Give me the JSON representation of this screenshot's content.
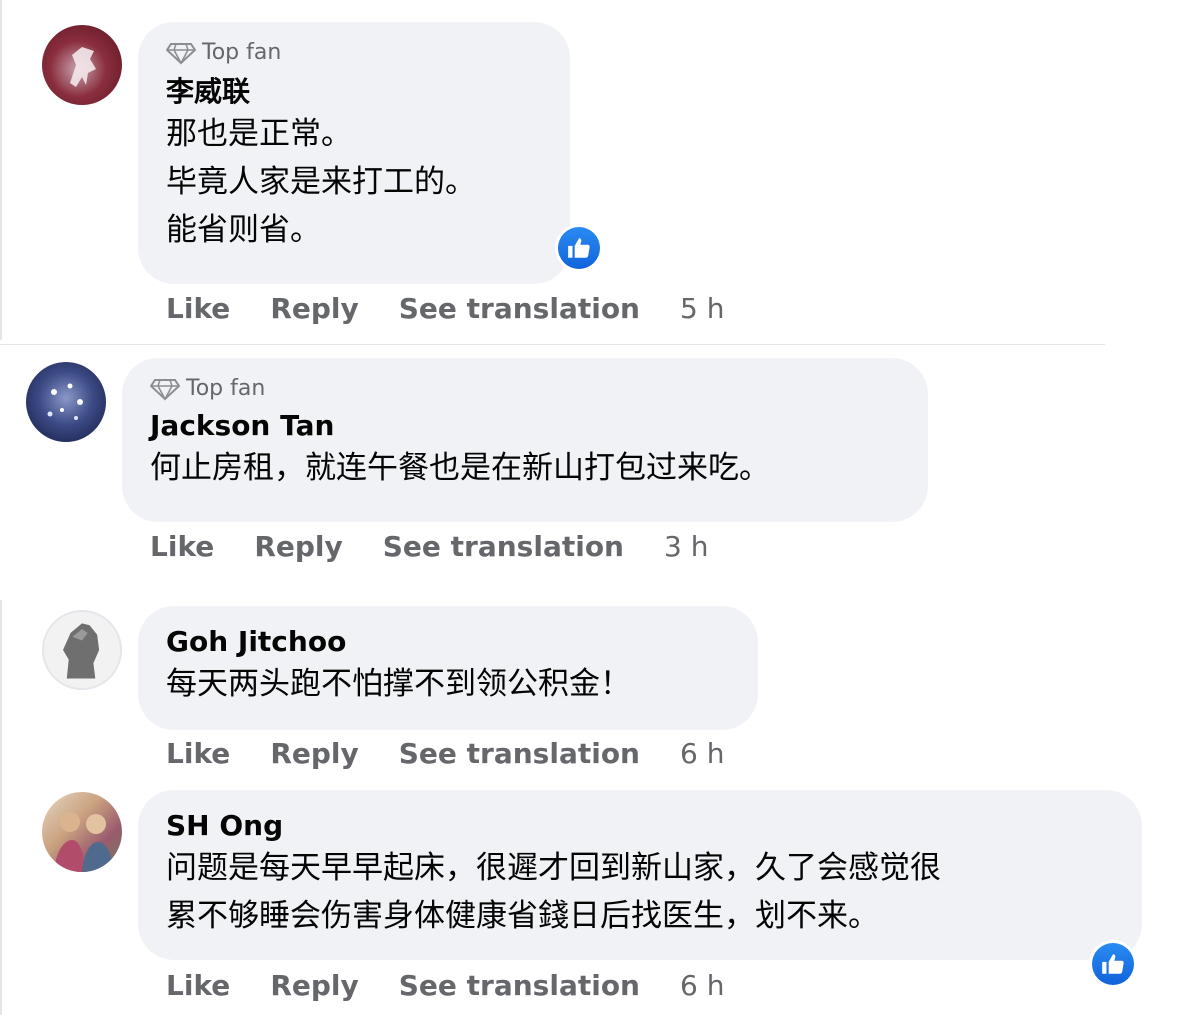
{
  "comments": [
    {
      "badge": "Top fan",
      "author": "李威联",
      "text": "那也是正常。\n毕竟人家是来打工的。\n能省则省。",
      "actions": {
        "like": "Like",
        "reply": "Reply",
        "translate": "See translation",
        "time": "5 h"
      },
      "reaction": "like-icon"
    },
    {
      "badge": "Top fan",
      "author": "Jackson Tan",
      "text": "何止房租，就连午餐也是在新山打包过来吃。",
      "actions": {
        "like": "Like",
        "reply": "Reply",
        "translate": "See translation",
        "time": "3 h"
      }
    },
    {
      "author": "Goh Jitchoo",
      "text": "每天两头跑不怕撑不到领公积金！",
      "actions": {
        "like": "Like",
        "reply": "Reply",
        "translate": "See translation",
        "time": "6 h"
      }
    },
    {
      "author": "SH Ong",
      "text": "问题是每天早早起床，很遲才回到新山家，久了会感觉很\n累不够睡会伤害身体健康省錢日后找医生，划不来。",
      "actions": {
        "like": "Like",
        "reply": "Reply",
        "translate": "See translation",
        "time": "6 h"
      },
      "reaction": "like-icon"
    }
  ],
  "colors": {
    "bubble": "#f0f2f5",
    "secondary_text": "#65676b",
    "primary_text": "#050505",
    "like_blue": "#1877f2"
  }
}
